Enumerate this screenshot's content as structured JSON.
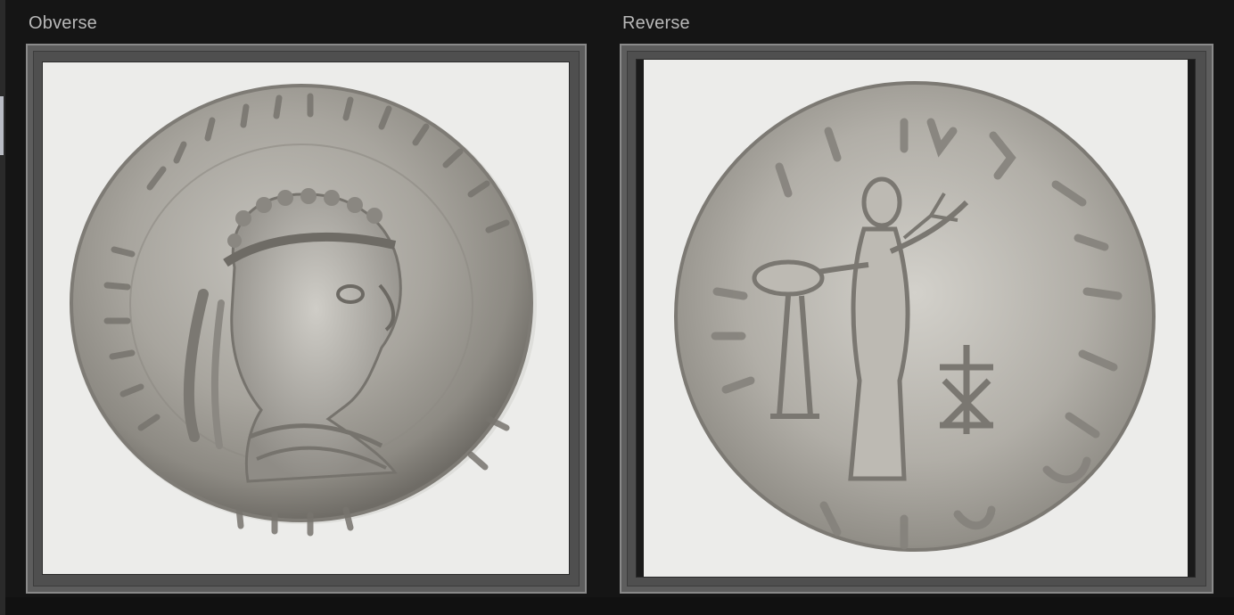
{
  "panels": {
    "obverse": {
      "label": "Obverse"
    },
    "reverse": {
      "label": "Reverse"
    }
  },
  "colors": {
    "background": "#151515",
    "frame": "#4f4f4f",
    "photo_background": "#ececea",
    "coin_silver": "#a9a7a1",
    "label": "#b8b8b8"
  },
  "images": {
    "obverse": "silver-coin-obverse-portrait",
    "reverse": "silver-coin-reverse-standing-figure"
  }
}
